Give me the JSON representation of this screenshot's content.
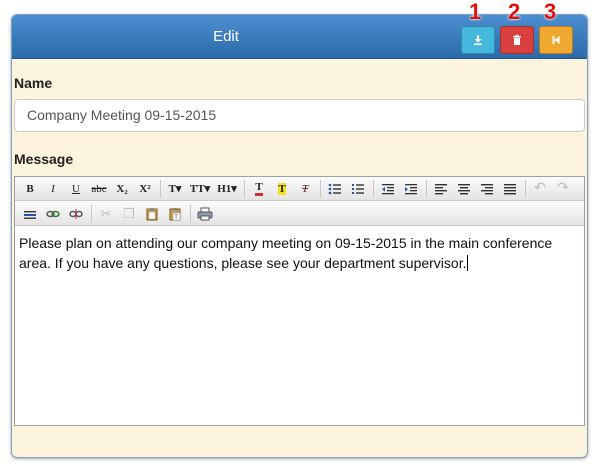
{
  "header": {
    "title": "Edit"
  },
  "actions": [
    {
      "callout": "1",
      "name": "save",
      "icon": "download-icon",
      "color": "#45b8de"
    },
    {
      "callout": "2",
      "name": "delete",
      "icon": "trash-icon",
      "color": "#d84040"
    },
    {
      "callout": "3",
      "name": "back",
      "icon": "skip-back-icon",
      "color": "#f0a830"
    }
  ],
  "form": {
    "name_label": "Name",
    "name_value": "Company Meeting 09-15-2015",
    "message_label": "Message",
    "message_text": "Please plan on attending our company meeting on 09-15-2015 in the main conference area.  If you have any questions, please see your department supervisor."
  },
  "toolbar": {
    "row1": [
      {
        "icon": "bold-icon",
        "glyph": "B"
      },
      {
        "icon": "italic-icon",
        "glyph": "I"
      },
      {
        "icon": "underline-icon",
        "glyph": "U"
      },
      {
        "icon": "strikethrough-icon",
        "glyph": "abc"
      },
      {
        "icon": "subscript-icon",
        "glyph": "X₂"
      },
      {
        "icon": "superscript-icon",
        "glyph": "X²"
      },
      {
        "icon": "font-family-icon",
        "glyph": "T▾"
      },
      {
        "icon": "font-size-icon",
        "glyph": "TT▾"
      },
      {
        "icon": "heading-icon",
        "glyph": "H1▾"
      },
      {
        "icon": "text-color-icon",
        "glyph": "T"
      },
      {
        "icon": "highlight-icon",
        "glyph": "T"
      },
      {
        "icon": "clear-format-icon",
        "glyph": "T"
      },
      {
        "icon": "bullet-list-icon",
        "glyph": ""
      },
      {
        "icon": "numbered-list-icon",
        "glyph": ""
      },
      {
        "icon": "outdent-icon",
        "glyph": ""
      },
      {
        "icon": "indent-icon",
        "glyph": ""
      },
      {
        "icon": "align-left-icon",
        "glyph": ""
      },
      {
        "icon": "align-center-icon",
        "glyph": ""
      },
      {
        "icon": "align-right-icon",
        "glyph": ""
      },
      {
        "icon": "justify-icon",
        "glyph": ""
      },
      {
        "icon": "undo-icon",
        "glyph": "↶"
      },
      {
        "icon": "redo-icon",
        "glyph": "↷"
      }
    ],
    "row2": [
      {
        "icon": "horizontal-rule-icon",
        "glyph": ""
      },
      {
        "icon": "link-icon",
        "glyph": "🔗"
      },
      {
        "icon": "unlink-icon",
        "glyph": "⛓"
      },
      {
        "icon": "cut-icon",
        "glyph": "✂"
      },
      {
        "icon": "copy-icon",
        "glyph": "❐"
      },
      {
        "icon": "paste-icon",
        "glyph": "📋"
      },
      {
        "icon": "paste-text-icon",
        "glyph": "📋"
      },
      {
        "icon": "print-icon",
        "glyph": "⎙"
      }
    ]
  }
}
